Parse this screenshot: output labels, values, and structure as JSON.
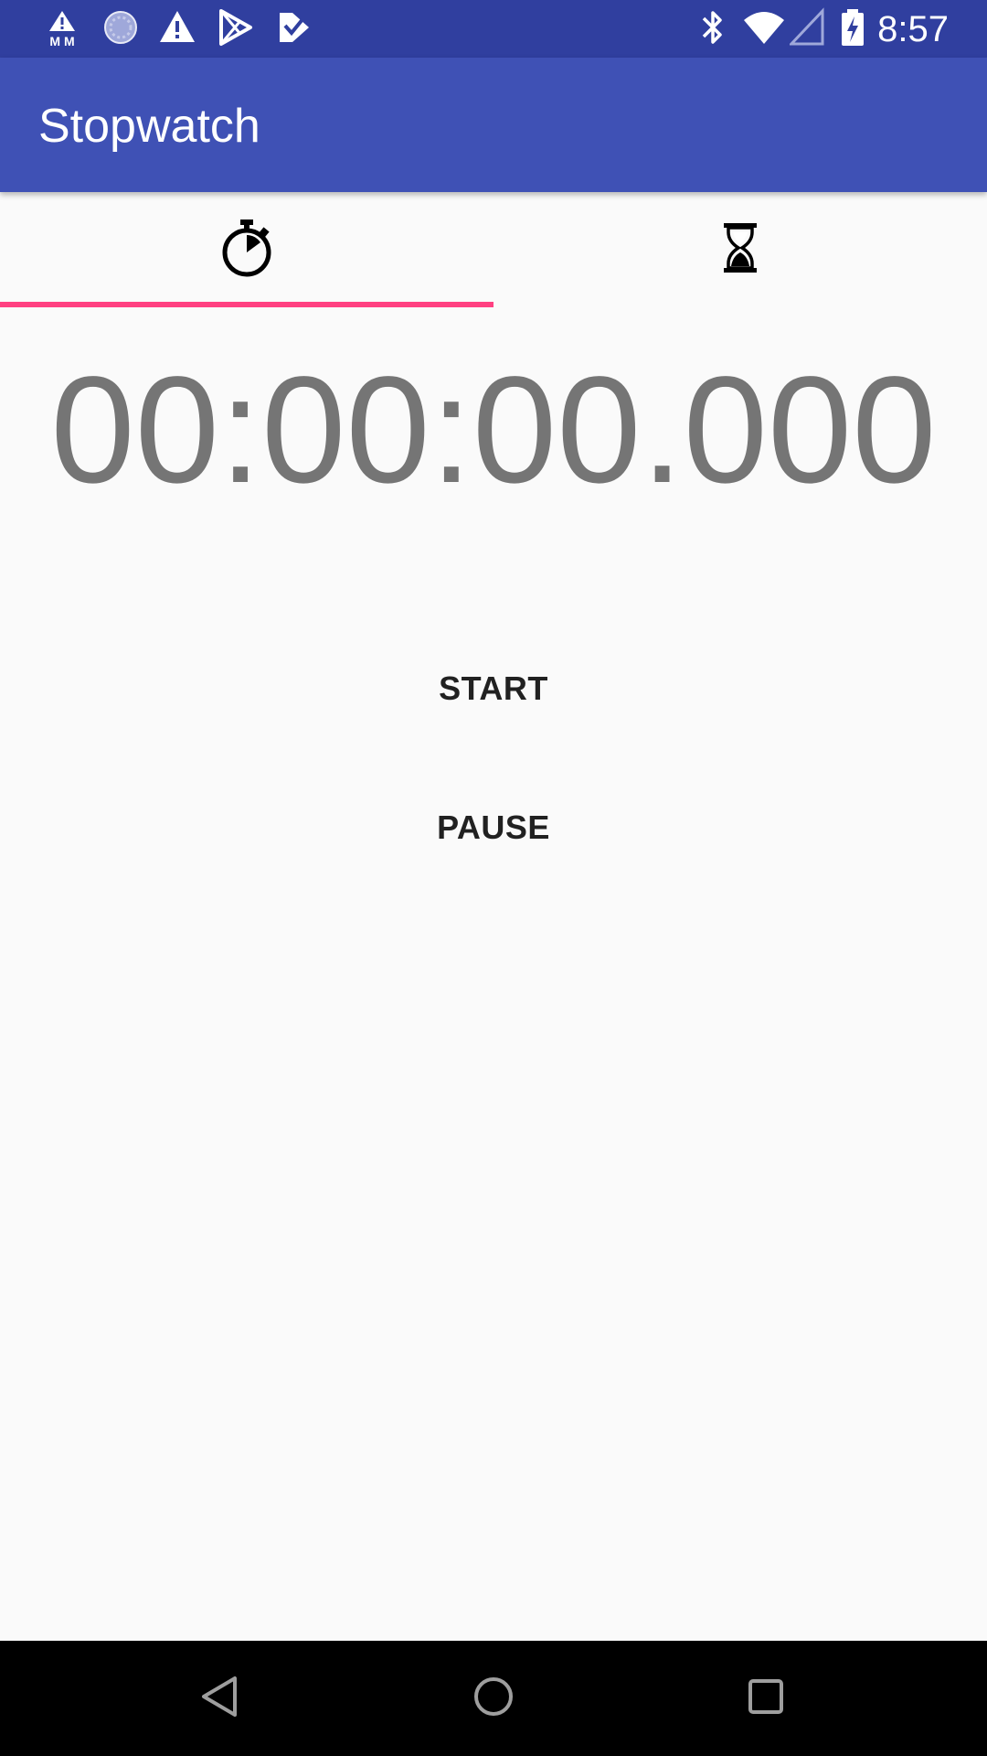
{
  "status_bar": {
    "time": "8:57",
    "left_icons": [
      "mm-alert-icon",
      "sync-circle-icon",
      "warning-icon",
      "play-store-icon",
      "task-check-icon"
    ],
    "right_icons": [
      "bluetooth-icon",
      "wifi-icon",
      "signal-icon",
      "battery-charging-icon"
    ]
  },
  "app_bar": {
    "title": "Stopwatch"
  },
  "tabs": [
    {
      "icon": "stopwatch-icon",
      "selected": true
    },
    {
      "icon": "hourglass-icon",
      "selected": false
    }
  ],
  "stopwatch": {
    "time": "00:00:00.000"
  },
  "buttons": {
    "start_label": "START",
    "pause_label": "PAUSE"
  },
  "nav_bar": {
    "icons": [
      "back-icon",
      "home-icon",
      "recents-icon"
    ]
  },
  "colors": {
    "status_bar": "#303f9f",
    "app_bar": "#3f51b5",
    "tab_indicator": "#ff4081",
    "time_text": "#757575",
    "background": "#fafafa"
  }
}
